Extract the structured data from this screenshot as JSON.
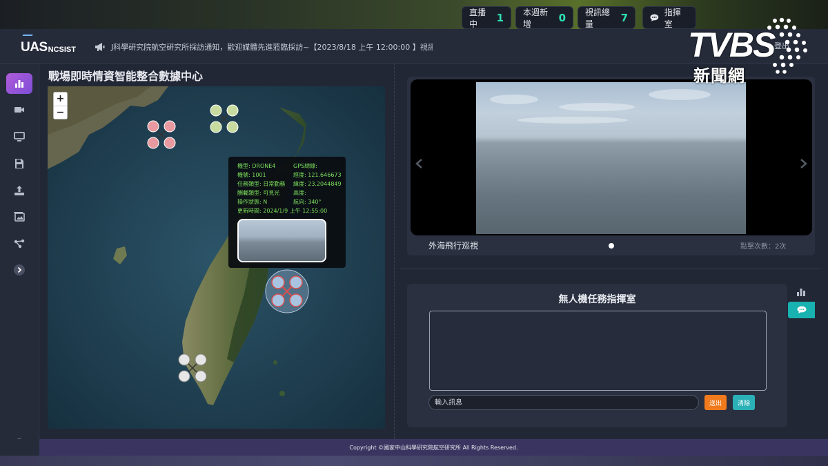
{
  "header": {
    "logo_main": "UAS",
    "logo_sub": "NCSIST",
    "announcement": "J科學研究院航空研究所採訪通知，歡迎媒體先進蒞臨採訪~【2023/8/18 上午 12:00:00 】視訊",
    "stats": {
      "live_label": "直播中",
      "live_value": "1",
      "week_label": "本週新增",
      "week_value": "0",
      "total_label": "視訊總量",
      "total_value": "7",
      "room_label": "指揮室"
    },
    "user_link": "登出"
  },
  "watermark": {
    "brand": "TVBS",
    "sub": "新聞網"
  },
  "sidebar": {
    "items": [
      "chart-icon",
      "video-icon",
      "monitor-icon",
      "save-icon",
      "upload-icon",
      "gallery-icon",
      "network-icon",
      "expand-icon",
      "chat-icon"
    ]
  },
  "page": {
    "title": "戰場即時情資智能整合數據中心"
  },
  "map": {
    "zoom_in": "+",
    "zoom_out": "−",
    "popup": {
      "name": "機型: DRONE4",
      "id": "機號: 1001",
      "task": "任務類型: 日常勤務",
      "sensor": "酬載類型: 可見光",
      "status": "操作狀態: N",
      "updated": "更新時間: 2024/1/9 上午 12:55:00",
      "gps": "GPS總線:",
      "lon": "經度: 121.646673",
      "lat": "緯度: 23.2044849",
      "alt": "高度:",
      "heading": "航向: 340°"
    },
    "drone_colors": {
      "pink": "#e89aa0",
      "green": "#c9dca0",
      "blue": "#a8c4e0",
      "white": "#e6e6e6"
    }
  },
  "video": {
    "caption": "外海飛行巡視",
    "view_count": "點擊次數：2次"
  },
  "room": {
    "title": "無人機任務指揮室",
    "input_placeholder": "輸入訊息",
    "send_label": "送出",
    "clear_label": "清除"
  },
  "footer": {
    "copyright": "Copyright ©國家中山科學研究院航空研究所 All Rights Reserved."
  },
  "colors": {
    "accent": "#2ee0b5",
    "send": "#f07a1c",
    "clear": "#2bb0b7",
    "popup_text": "#7de05c"
  }
}
